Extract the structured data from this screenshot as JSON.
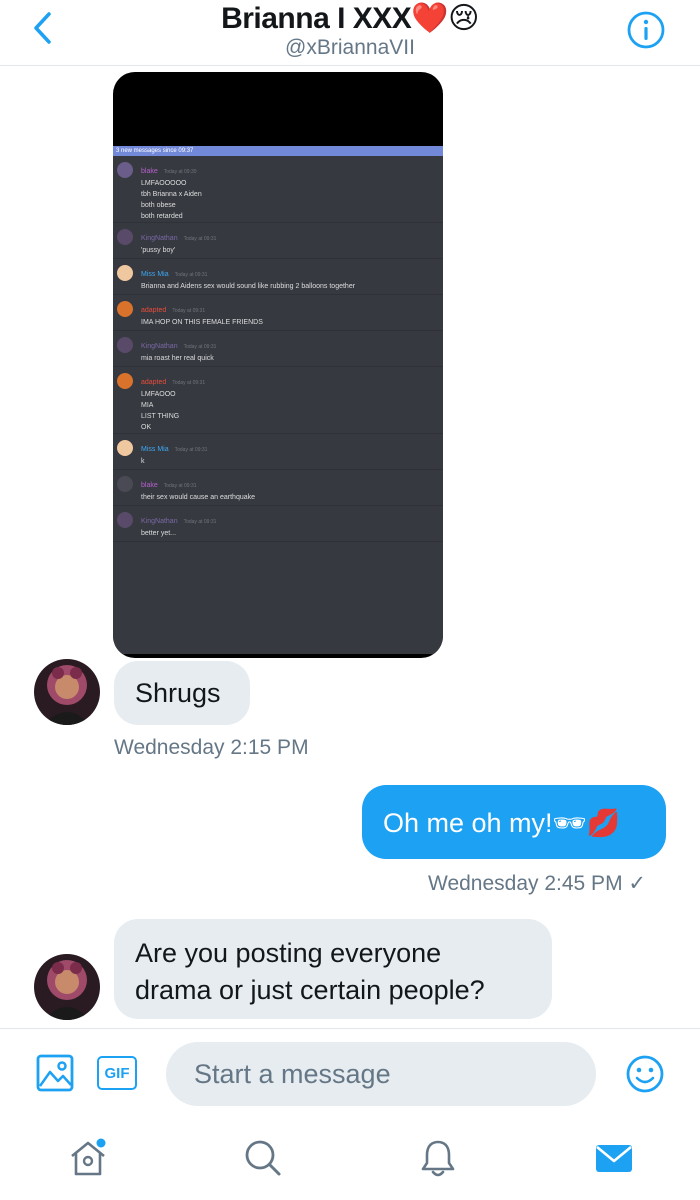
{
  "header": {
    "title": "Brianna I XXX❤️😢",
    "handle": "@xBriannaVII",
    "back_icon": "chevron-left-icon",
    "info_icon": "info-icon"
  },
  "shared_image": {
    "new_messages_bar": "3 new messages since 09:37",
    "messages": [
      {
        "user": "blake",
        "user_color": "#b660cd",
        "time": "Today at 09:30",
        "lines": [
          "LMFAOOOOO",
          "tbh Brianna x Aiden",
          "both obese",
          "both retarded"
        ]
      },
      {
        "user": "KingNathan",
        "user_color": "#7b68a8",
        "time": "Today at 09:31",
        "lines": [
          "'pussy boy'"
        ]
      },
      {
        "user": "Miss Mia",
        "user_color": "#3ea8f3",
        "time": "Today at 09:31",
        "lines": [
          "Brianna and Aidens sex would sound like rubbing 2 balloons together"
        ]
      },
      {
        "user": "adapted",
        "user_color": "#e74c3c",
        "time": "Today at 09:31",
        "lines": [
          "IMA HOP ON THIS FEMALE FRIENDS"
        ]
      },
      {
        "user": "KingNathan",
        "user_color": "#7b68a8",
        "time": "Today at 09:31",
        "lines": [
          "mia roast her real quick"
        ]
      },
      {
        "user": "adapted",
        "user_color": "#e74c3c",
        "time": "Today at 09:31",
        "lines": [
          "LMFAOOO",
          "MIA",
          "LIST THING",
          "OK"
        ]
      },
      {
        "user": "Miss Mia",
        "user_color": "#3ea8f3",
        "time": "Today at 09:31",
        "lines": [
          "k"
        ]
      },
      {
        "user": "blake",
        "user_color": "#b660cd",
        "time": "Today at 09:31",
        "lines": [
          "their sex would cause an earthquake"
        ]
      },
      {
        "user": "KingNathan",
        "user_color": "#7b68a8",
        "time": "Today at 09:31",
        "lines": [
          "better yet..."
        ]
      }
    ]
  },
  "messages": {
    "shrugs": "Shrugs",
    "time1": "Wednesday 2:15 PM",
    "sent": "Oh me oh my!🕶💋",
    "time2": "Wednesday 2:45 PM ✓",
    "question_line1": "Are you posting everyone",
    "question_line2": "drama or just certain people?"
  },
  "composer": {
    "placeholder": "Start a message",
    "gif_label": "GIF",
    "image_icon": "image-icon",
    "emoji_icon": "emoji-icon"
  },
  "tabbar": {
    "home_icon": "home-icon",
    "search_icon": "search-icon",
    "notifications_icon": "bell-icon",
    "messages_icon": "mail-icon"
  },
  "colors": {
    "accent": "#1da1f2",
    "bubble_in": "#e6ecf0",
    "secondary_text": "#657786"
  }
}
